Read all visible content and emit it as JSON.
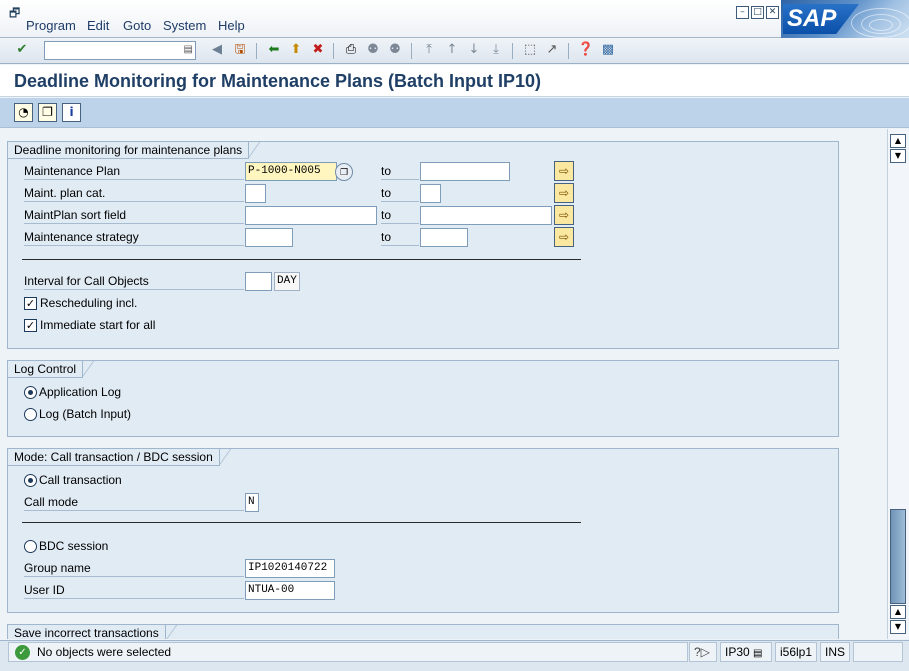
{
  "menu": {
    "items": [
      "Program",
      "Edit",
      "Goto",
      "System",
      "Help"
    ],
    "underlines": [
      "P",
      "E",
      "G",
      "S",
      "H"
    ]
  },
  "window_buttons": [
    "minimize",
    "maximize",
    "close"
  ],
  "logo": "SAP",
  "command_field": {
    "value": ""
  },
  "page": {
    "title": "Deadline Monitoring for Maintenance Plans (Batch Input IP10)"
  },
  "groups": {
    "deadline": {
      "title": "Deadline monitoring for maintenance plans",
      "to_label": "to",
      "rows": [
        {
          "label": "Maintenance Plan",
          "from": "P-1000-N005",
          "to": ""
        },
        {
          "label": "Maint. plan cat.",
          "from": "",
          "to": ""
        },
        {
          "label": "MaintPlan sort field",
          "from": "",
          "to": ""
        },
        {
          "label": "Maintenance strategy",
          "from": "",
          "to": ""
        }
      ],
      "interval_label": "Interval for Call Objects",
      "interval_value": "",
      "interval_unit": "DAY",
      "rescheduling_label": "Rescheduling incl.",
      "rescheduling_checked": true,
      "immediate_label": "Immediate start for all",
      "immediate_checked": true
    },
    "log": {
      "title": "Log Control",
      "options": [
        {
          "label": "Application Log",
          "selected": true
        },
        {
          "label": "Log (Batch Input)",
          "selected": false
        }
      ]
    },
    "mode": {
      "title": "Mode: Call transaction / BDC session",
      "call_transaction_label": "Call transaction",
      "call_transaction_selected": true,
      "call_mode_label": "Call mode",
      "call_mode_value": "N",
      "bdc_session_label": "BDC session",
      "bdc_session_selected": false,
      "group_name_label": "Group name",
      "group_name_value": "IP1020140722",
      "user_id_label": "User ID",
      "user_id_value": "NTUA-00"
    },
    "save": {
      "title": "Save incorrect transactions"
    }
  },
  "status": {
    "message": "No objects were selected",
    "transaction": "IP30",
    "server": "i56lp1",
    "mode": "INS"
  }
}
